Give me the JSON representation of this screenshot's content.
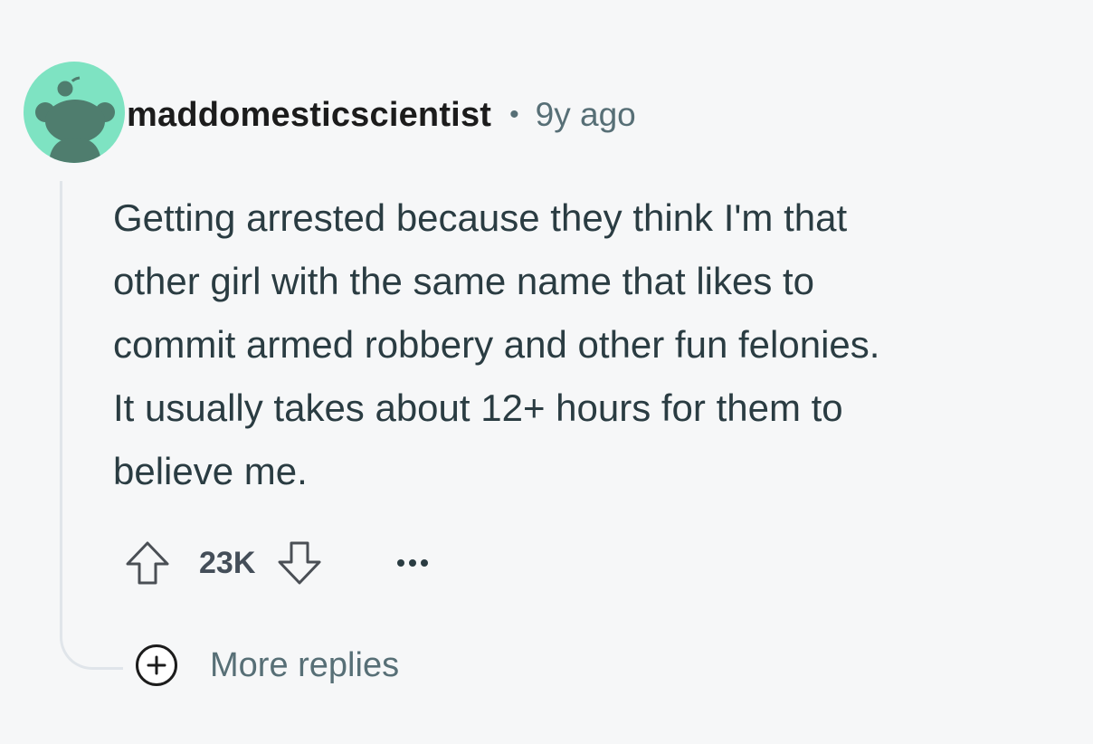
{
  "comment": {
    "username": "maddomesticscientist",
    "separator": "•",
    "time": "9y ago",
    "body_lines": [
      "Getting arrested because they think I'm that",
      "other girl with the same name that likes to",
      "commit armed robbery and other fun felonies.",
      "It usually takes about 12+ hours for them to",
      "believe me."
    ],
    "score": "23K",
    "more_replies_label": "More replies"
  },
  "icons": {
    "avatar": "reddit-snoo-avatar",
    "upvote": "upvote-arrow-icon",
    "downvote": "downvote-arrow-icon",
    "more": "ellipsis-icon",
    "expand": "plus-circle-icon"
  },
  "colors": {
    "background": "#f6f7f8",
    "avatar_bg": "#7ee3c2",
    "avatar_fg": "#4f7d6e",
    "meta_text": "#576f76",
    "body_text": "#2a3c42",
    "thread_line": "#e0e5ea"
  }
}
